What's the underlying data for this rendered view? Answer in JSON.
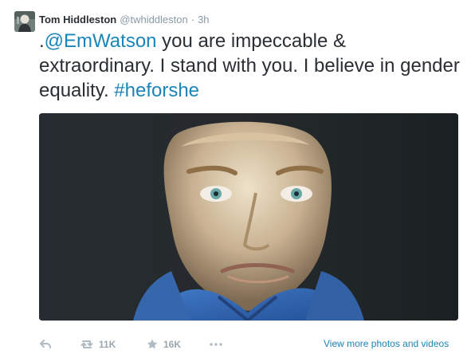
{
  "tweet": {
    "author": {
      "display_name": "Tom Hiddleston",
      "username": "@twhiddleston"
    },
    "separator": "·",
    "time": "3h",
    "text": {
      "prefix": ".",
      "mention": "@EmWatson",
      "body": " you are impeccable & extraordinary. I stand with you. I believe in gender equality. ",
      "hashtag": "#heforshe"
    },
    "actions": {
      "retweet_count": "11K",
      "favorite_count": "16K"
    },
    "view_more_label": "View more photos and videos",
    "icons": {
      "avatar": "profile-photo",
      "reply": "reply-icon",
      "retweet": "retweet-icon",
      "favorite": "star-icon",
      "more": "more-icon"
    }
  },
  "colors": {
    "text": "#292f33",
    "secondary_text": "#8899a6",
    "link": "#1a85b8",
    "icon_muted": "#b0bac2"
  }
}
